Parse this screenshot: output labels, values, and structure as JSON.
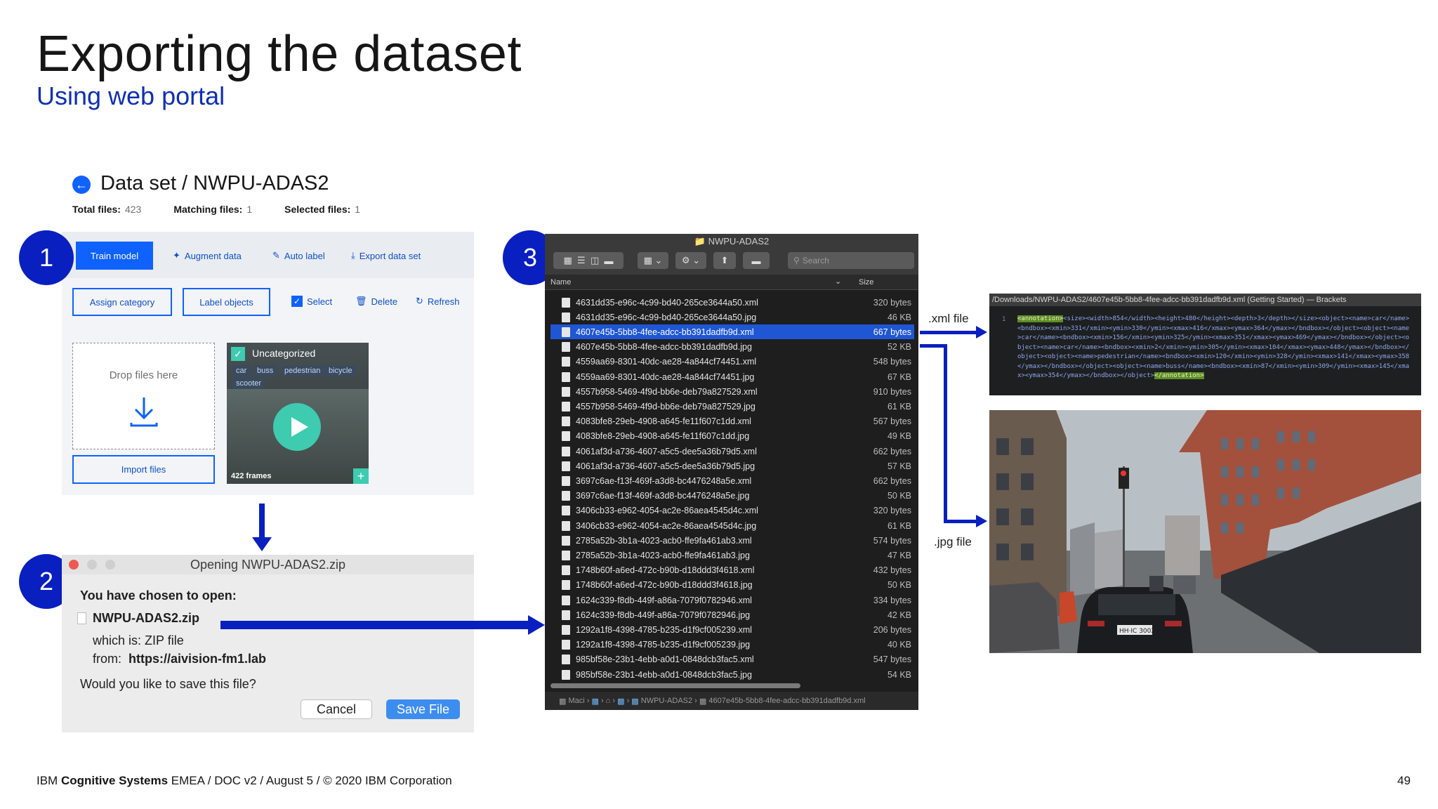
{
  "slide": {
    "title": "Exporting the dataset",
    "subtitle": "Using web portal",
    "steps": [
      "1",
      "2",
      "3"
    ],
    "footer": {
      "brand_prefix": "IBM ",
      "brand_bold": "Cognitive Systems",
      "rest": " EMEA / DOC v2 / August 5 / © 2020 IBM Corporation"
    },
    "page_number": "49"
  },
  "dataset": {
    "title": "Data set / NWPU-ADAS2",
    "stats": [
      {
        "label": "Total files:",
        "value": "423"
      },
      {
        "label": "Matching files:",
        "value": "1"
      },
      {
        "label": "Selected files:",
        "value": "1"
      }
    ],
    "toolbar": {
      "train_model": "Train model",
      "augment_data": "Augment data",
      "auto_label": "Auto label",
      "export_data_set": "Export data set",
      "assign_category": "Assign category",
      "label_objects": "Label objects",
      "select": "Select",
      "delete": "Delete",
      "refresh": "Refresh"
    },
    "drop_zone": {
      "text": "Drop files here",
      "import": "Import files"
    },
    "thumbnail": {
      "title": "Uncategorized",
      "tags": [
        "car",
        "buss",
        "pedestrian",
        "bicycle",
        "scooter"
      ],
      "frames": "422 frames"
    }
  },
  "dialog": {
    "title": "Opening NWPU-ADAS2.zip",
    "chosen": "You have chosen to open:",
    "filename": "NWPU-ADAS2.zip",
    "which_is": "which is:  ZIP file",
    "from_label": "from:",
    "from_url": "https://aivision-fm1.lab",
    "question": "Would you like to save this file?",
    "cancel": "Cancel",
    "save": "Save File"
  },
  "finder": {
    "title": "NWPU-ADAS2",
    "search_placeholder": "Search",
    "col_name": "Name",
    "col_size": "Size",
    "selected_index": 2,
    "files": [
      {
        "name": "4631dd35-e96c-4c99-bd40-265ce3644a50.xml",
        "size": "320 bytes"
      },
      {
        "name": "4631dd35-e96c-4c99-bd40-265ce3644a50.jpg",
        "size": "46 KB"
      },
      {
        "name": "4607e45b-5bb8-4fee-adcc-bb391dadfb9d.xml",
        "size": "667 bytes"
      },
      {
        "name": "4607e45b-5bb8-4fee-adcc-bb391dadfb9d.jpg",
        "size": "52 KB"
      },
      {
        "name": "4559aa69-8301-40dc-ae28-4a844cf74451.xml",
        "size": "548 bytes"
      },
      {
        "name": "4559aa69-8301-40dc-ae28-4a844cf74451.jpg",
        "size": "67 KB"
      },
      {
        "name": "4557b958-5469-4f9d-bb6e-deb79a827529.xml",
        "size": "910 bytes"
      },
      {
        "name": "4557b958-5469-4f9d-bb6e-deb79a827529.jpg",
        "size": "61 KB"
      },
      {
        "name": "4083bfe8-29eb-4908-a645-fe11f607c1dd.xml",
        "size": "567 bytes"
      },
      {
        "name": "4083bfe8-29eb-4908-a645-fe11f607c1dd.jpg",
        "size": "49 KB"
      },
      {
        "name": "4061af3d-a736-4607-a5c5-dee5a36b79d5.xml",
        "size": "662 bytes"
      },
      {
        "name": "4061af3d-a736-4607-a5c5-dee5a36b79d5.jpg",
        "size": "57 KB"
      },
      {
        "name": "3697c6ae-f13f-469f-a3d8-bc4476248a5e.xml",
        "size": "662 bytes"
      },
      {
        "name": "3697c6ae-f13f-469f-a3d8-bc4476248a5e.jpg",
        "size": "50 KB"
      },
      {
        "name": "3406cb33-e962-4054-ac2e-86aea4545d4c.xml",
        "size": "320 bytes"
      },
      {
        "name": "3406cb33-e962-4054-ac2e-86aea4545d4c.jpg",
        "size": "61 KB"
      },
      {
        "name": "2785a52b-3b1a-4023-acb0-ffe9fa461ab3.xml",
        "size": "574 bytes"
      },
      {
        "name": "2785a52b-3b1a-4023-acb0-ffe9fa461ab3.jpg",
        "size": "47 KB"
      },
      {
        "name": "1748b60f-a6ed-472c-b90b-d18ddd3f4618.xml",
        "size": "432 bytes"
      },
      {
        "name": "1748b60f-a6ed-472c-b90b-d18ddd3f4618.jpg",
        "size": "50 KB"
      },
      {
        "name": "1624c339-f8db-449f-a86a-7079f0782946.xml",
        "size": "334 bytes"
      },
      {
        "name": "1624c339-f8db-449f-a86a-7079f0782946.jpg",
        "size": "42 KB"
      },
      {
        "name": "1292a1f8-4398-4785-b235-d1f9cf005239.xml",
        "size": "206 bytes"
      },
      {
        "name": "1292a1f8-4398-4785-b235-d1f9cf005239.jpg",
        "size": "40 KB"
      },
      {
        "name": "985bf58e-23b1-4ebb-a0d1-0848dcb3fac5.xml",
        "size": "547 bytes"
      },
      {
        "name": "985bf58e-23b1-4ebb-a0d1-0848dcb3fac5.jpg",
        "size": "54 KB"
      }
    ],
    "path": [
      "Maci",
      "NWPU-ADAS2",
      "4607e45b-5bb8-4fee-adcc-bb391dadfb9d.xml"
    ]
  },
  "annotations": {
    "xml_label": ".xml file",
    "jpg_label": ".jpg file"
  },
  "xml_viewer": {
    "title": "/Downloads/NWPU-ADAS2/4607e45b-5bb8-4fee-adcc-bb391dadfb9d.xml (Getting Started) — Brackets",
    "line_number": "1",
    "open_tag": "<annotation>",
    "body": "<size><width>854</width><height>480</height><depth>3</depth></size><object><name>car</name><bndbox><xmin>331</xmin><ymin>330</ymin><xmax>416</xmax><ymax>364</ymax></bndbox></object><object><name>car</name><bndbox><xmin>156</xmin><ymin>325</ymin><xmax>351</xmax><ymax>469</ymax></bndbox></object><object><name>car</name><bndbox><xmin>2</xmin><ymin>305</ymin><xmax>104</xmax><ymax>448</ymax></bndbox></object><object><name>pedestrian</name><bndbox><xmin>120</xmin><ymin>328</ymin><xmax>141</xmax><ymax>358</ymax></bndbox></object><object><name>buss</name><bndbox><xmin>87</xmin><ymin>309</ymin><xmax>145</xmax><ymax>354</ymax></bndbox></object>",
    "close_tag": "</annotation>"
  },
  "photo": {
    "plate": "HH·IC 3002"
  },
  "colors": {
    "accent_blue": "#0f62fe",
    "badge_blue": "#0a1fc0",
    "finder_selection": "#1f56d3",
    "teal": "#3ecbb0"
  }
}
